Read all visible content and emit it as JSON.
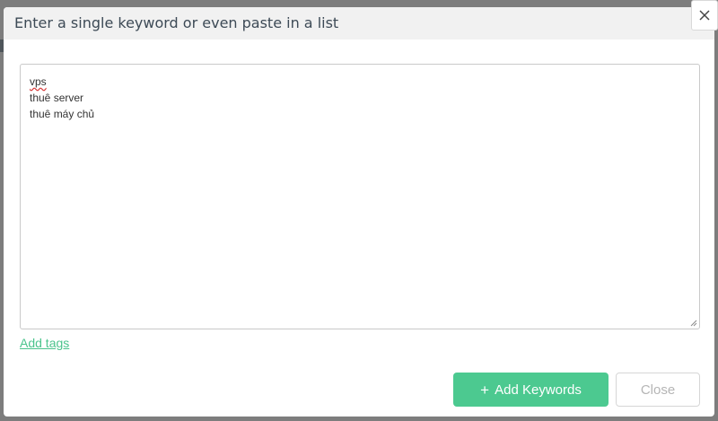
{
  "modal": {
    "title": "Enter a single keyword or even paste in a list",
    "close_icon": "close-icon"
  },
  "keywords": {
    "lines": [
      "vps",
      "thuê server",
      "thuê máy chủ"
    ]
  },
  "links": {
    "add_tags": "Add tags"
  },
  "buttons": {
    "add_keywords_icon": "+",
    "add_keywords": "Add Keywords",
    "close": "Close"
  },
  "colors": {
    "accent": "#4cc990",
    "link": "#4cc48d",
    "header_bg": "#f1f1f1",
    "title_text": "#3d4a56",
    "overlay": "#7d7d7d"
  }
}
